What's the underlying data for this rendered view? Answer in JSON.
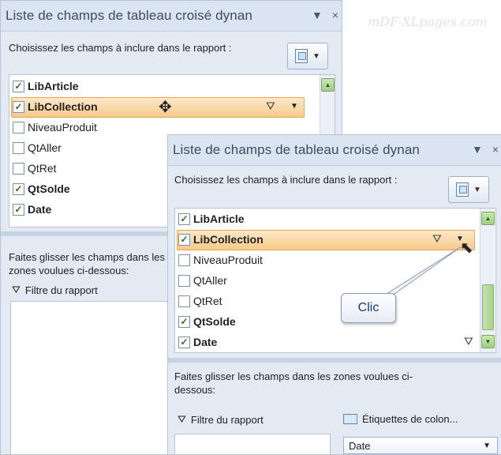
{
  "watermark": "mDF-XLpages.com",
  "panel_back": {
    "title": "Liste de champs de tableau croisé dynan",
    "instructions": "Choisissez les champs à inclure dans le rapport :",
    "fields": [
      {
        "label": "LibArticle",
        "checked": true,
        "bold": true
      },
      {
        "label": "LibCollection",
        "checked": true,
        "bold": true
      },
      {
        "label": "NiveauProduit",
        "checked": false,
        "bold": false
      },
      {
        "label": "QtAller",
        "checked": false,
        "bold": false
      },
      {
        "label": "QtRet",
        "checked": false,
        "bold": false
      },
      {
        "label": "QtSolde",
        "checked": true,
        "bold": true
      },
      {
        "label": "Date",
        "checked": true,
        "bold": true
      }
    ],
    "drag_instructions": "Faites glisser les champs dans les zones voulues ci-dessous:",
    "report_filter_label": "Filtre du rapport"
  },
  "panel_front": {
    "title": "Liste de champs de tableau croisé dynan",
    "instructions": "Choisissez les champs à inclure dans le rapport :",
    "fields": [
      {
        "label": "LibArticle",
        "checked": true,
        "bold": true
      },
      {
        "label": "LibCollection",
        "checked": true,
        "bold": true
      },
      {
        "label": "NiveauProduit",
        "checked": false,
        "bold": false
      },
      {
        "label": "QtAller",
        "checked": false,
        "bold": false
      },
      {
        "label": "QtRet",
        "checked": false,
        "bold": false
      },
      {
        "label": "QtSolde",
        "checked": true,
        "bold": true
      },
      {
        "label": "Date",
        "checked": true,
        "bold": true
      }
    ],
    "drag_instructions": "Faites glisser les champs dans les zones voulues ci-dessous:",
    "report_filter_label": "Filtre du rapport",
    "column_labels_label": "Étiquettes de colon...",
    "column_field_value": "Date"
  },
  "callout_text": "Clic",
  "icons": {
    "dropdown": "▼",
    "close": "×",
    "filter": "⛛",
    "scroll_up": "▲",
    "scroll_down": "▼",
    "check": "✓"
  },
  "colors": {
    "highlight": "#f7c98a",
    "title_bar": "#dbe4f1",
    "scroll_green": "#9fcf84"
  }
}
